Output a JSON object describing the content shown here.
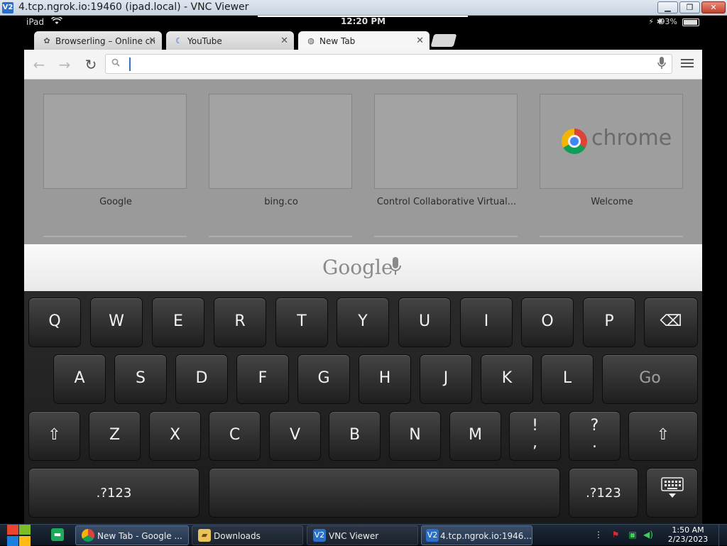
{
  "window": {
    "title": "4.tcp.ngrok.io:19460 (ipad.local) - VNC Viewer",
    "app_badge": "V2",
    "btn_min": "▁",
    "btn_max": "❐",
    "btn_close": "✕"
  },
  "statusbar": {
    "device": "iPad",
    "time": "12:20 PM",
    "battery": "93%",
    "signal": "⚡",
    "bluetooth": "✱"
  },
  "tabs": [
    {
      "label": "Browserling – Online cross-browser testing",
      "icon": "browserling-icon",
      "active": false
    },
    {
      "label": "YouTube",
      "icon": "youtube-icon",
      "active": false
    },
    {
      "label": "New Tab",
      "icon": "globe-icon",
      "active": true
    }
  ],
  "toolbar": {
    "back": "←",
    "forward": "→",
    "reload": "↻",
    "search_value": "",
    "search_placeholder": "",
    "search_icon": "🔍",
    "mic_icon": "🎤"
  },
  "most_visited": [
    {
      "label": "Google"
    },
    {
      "label": "bing.co"
    },
    {
      "label": "Control Collaborative Virtual..."
    },
    {
      "label": "Welcome",
      "brand": "chrome"
    }
  ],
  "google_bar": {
    "word": "Google",
    "mic": "🎤"
  },
  "keyboard": {
    "row1": [
      "Q",
      "W",
      "E",
      "R",
      "T",
      "Y",
      "U",
      "I",
      "O",
      "P"
    ],
    "backspace": "⌫",
    "row2": [
      "A",
      "S",
      "D",
      "F",
      "G",
      "H",
      "J",
      "K",
      "L"
    ],
    "go": "Go",
    "shift": "⇧",
    "row3": [
      "Z",
      "X",
      "C",
      "V",
      "B",
      "N",
      "M"
    ],
    "punct1_top": "!",
    "punct1_bottom": ",",
    "punct2_top": "?",
    "punct2_bottom": ".",
    "numbers": ".?123",
    "hide": "⌨"
  },
  "taskbar": {
    "items": [
      {
        "label": "New Tab - Google ...",
        "icon": "chrome-icon"
      },
      {
        "label": "Downloads",
        "icon": "folder-icon"
      },
      {
        "label": "VNC Viewer",
        "icon": "vnc-icon"
      },
      {
        "label": "4.tcp.ngrok.io:1946...",
        "icon": "vnc-icon"
      }
    ],
    "time": "1:50 AM",
    "date": "2/23/2023"
  },
  "colors": {
    "titlebar": "#c8d3e0",
    "chrome_red": "#db4437",
    "chrome_green": "#0f9d58",
    "chrome_yellow": "#f4b400",
    "chrome_blue": "#4285f4",
    "taskbar": "#1e2a3a"
  }
}
